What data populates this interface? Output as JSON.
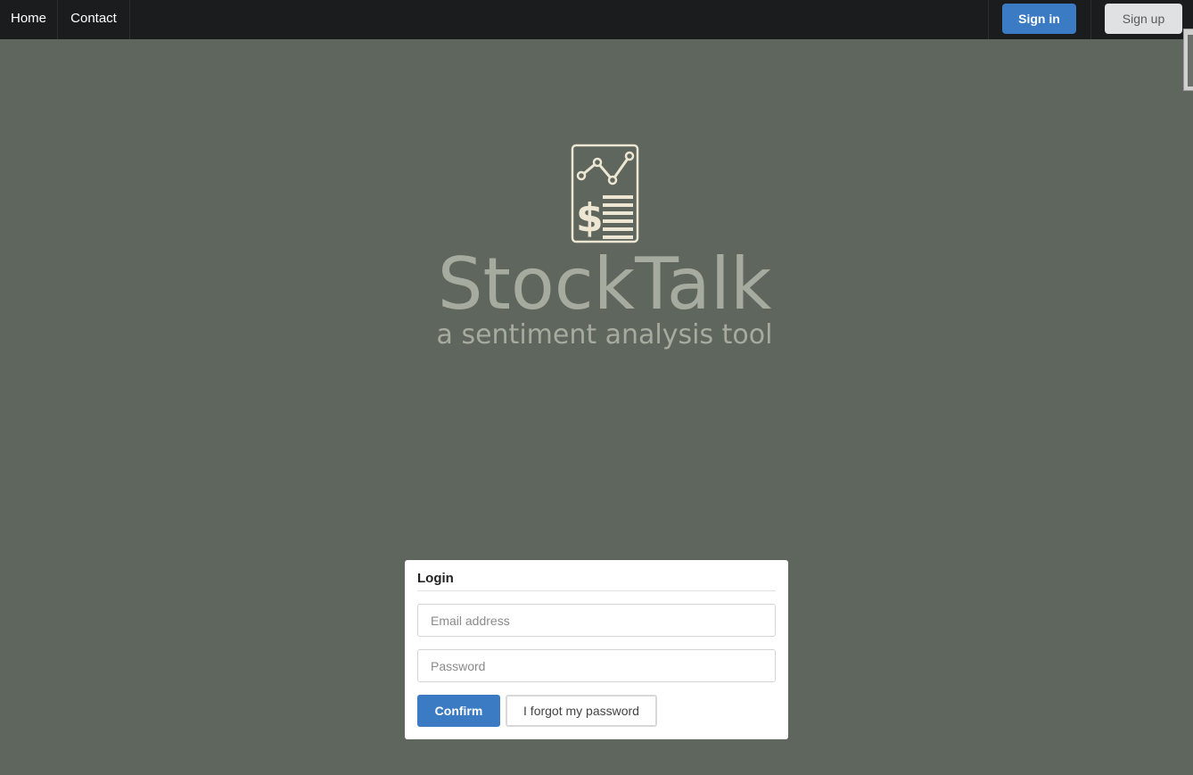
{
  "nav": {
    "home_label": "Home",
    "contact_label": "Contact",
    "signin_label": "Sign in",
    "signup_label": "Sign up"
  },
  "brand": {
    "title": "StockTalk",
    "subtitle": "a sentiment analysis tool",
    "logo_icon": "stock-report-icon"
  },
  "login": {
    "title": "Login",
    "email_placeholder": "Email address",
    "email_value": "",
    "password_placeholder": "Password",
    "password_value": "",
    "confirm_label": "Confirm",
    "forgot_label": "I forgot my password"
  },
  "colors": {
    "background": "#5f665d",
    "navbar": "#1b1c1e",
    "primary": "#3a7bc4",
    "brand_text": "#a6ab9f",
    "logo_stroke": "#ece6d2"
  }
}
